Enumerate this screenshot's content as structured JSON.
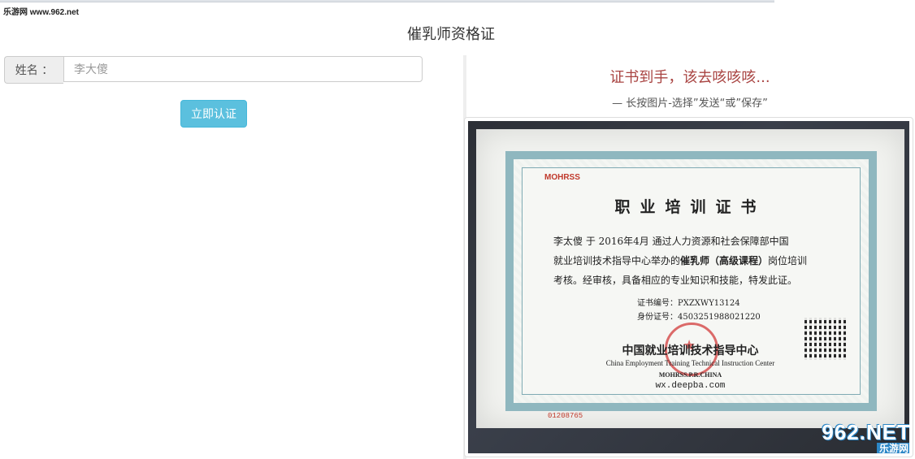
{
  "watermark": {
    "site": "乐游网 www.962.net"
  },
  "page": {
    "title": "催乳师资格证"
  },
  "form": {
    "name_label": "姓名 ：",
    "name_value": "李大傻",
    "submit_label": "立即认证"
  },
  "preview": {
    "headline": "证书到手，该去咳咳咳...",
    "hint": "— 长按图片-选择”发送“或”保存”"
  },
  "certificate": {
    "issuer_mark": "MOHRSS",
    "title": "职业培训证书",
    "body_line1": "李太傻  于 2016年4月 通过人力资源和社会保障部中国",
    "body_line2_pre": "就业培训技术指导中心举办的",
    "body_line2_course": "催乳师（高级课程）",
    "body_line2_post": "岗位培训",
    "body_line3": "考核。经审核，具备相应的专业知识和技能，特发此证。",
    "cert_no": "证书编号：PXZXWY13124",
    "id_no": "身份证号：4503251988021220",
    "center_cn": "中国就业培训技术指导中心",
    "center_en": "China Employment Training Technical Instruction Center",
    "center_abbr": "MOHRSS.P.R.CHINA",
    "website": "wx.deepba.com",
    "serial": "01208765"
  },
  "logo": {
    "big": "962.NET",
    "small": "乐游网"
  },
  "colors": {
    "accent_button": "#5bc0de",
    "headline": "#a94442"
  }
}
